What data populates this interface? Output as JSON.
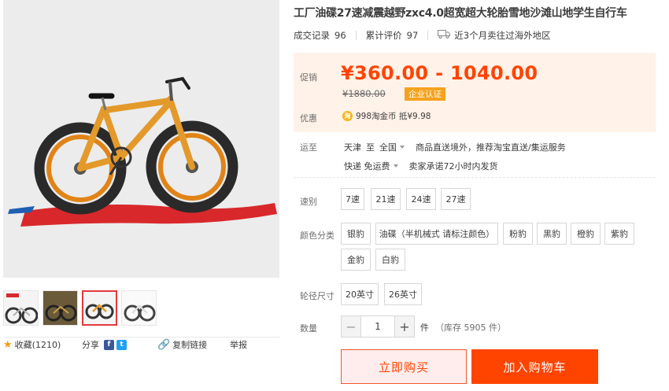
{
  "product": {
    "title": "工厂油碟27速减震越野zxc4.0超宽超大轮胎雪地沙滩山地学生自行车",
    "sales_label": "成交记录",
    "sales_count": "96",
    "reviews_label": "累计评价",
    "reviews_count": "97",
    "shipping_note": "近3个月卖往过海外地区"
  },
  "price": {
    "promo_label": "促销",
    "price_range": "¥360.00 - 1040.00",
    "original_price": "¥1880.00",
    "enterprise_tag": "企业认证",
    "discount_label": "优惠",
    "coin_icon_text": "淘",
    "coin_text": "998淘金币 抵¥9.98"
  },
  "shipping": {
    "label": "运至",
    "from": "天津",
    "to_word": "至",
    "destination": "全国",
    "service": "商品直送境外，推荐淘宝直送/集运服务",
    "method": "快递 免运费",
    "promise": "卖家承诺72小时内发货"
  },
  "options": {
    "speed_label": "速别",
    "speeds": [
      "7速",
      "21速",
      "24速",
      "27速"
    ],
    "color_label": "颜色分类",
    "colors": [
      "银豹",
      "油碟（半机械式 请标注颜色）",
      "粉豹",
      "黑豹",
      "橙豹",
      "紫豹",
      "金豹",
      "白豹"
    ],
    "size_label": "轮径尺寸",
    "sizes": [
      "20英寸",
      "26英寸"
    ]
  },
  "quantity": {
    "label": "数量",
    "value": "1",
    "minus": "−",
    "plus": "+",
    "unit": "件",
    "stock": "（库存 5905 件）"
  },
  "actions": {
    "buy_now": "立即购买",
    "add_to_cart": "加入购物车"
  },
  "gallery": {
    "favorite_label": "收藏(1210)",
    "share_label": "分享",
    "copy_link_label": "复制链接",
    "report_label": "举报"
  },
  "colors": {
    "accent": "#ff4400",
    "price_bg": "#fff2e8",
    "tag": "#f5a21f"
  }
}
